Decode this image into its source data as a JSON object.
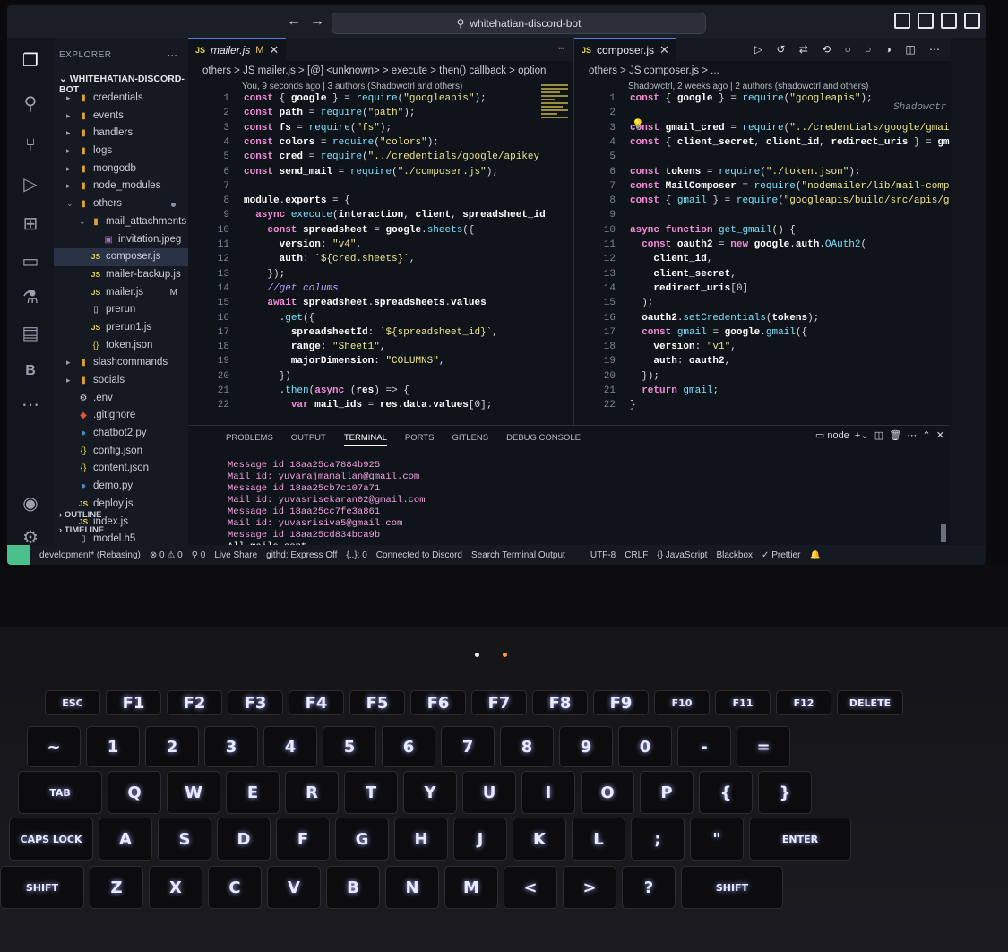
{
  "window": {
    "title": "whitehatian-discord-bot"
  },
  "explorer": {
    "header": "EXPLORER",
    "repo": "WHITEHATIAN-DISCORD-BOT",
    "items": [
      {
        "label": "credentials",
        "type": "folder",
        "indent": 1
      },
      {
        "label": "events",
        "type": "folder",
        "indent": 1
      },
      {
        "label": "handlers",
        "type": "folder",
        "indent": 1
      },
      {
        "label": "logs",
        "type": "folder",
        "indent": 1
      },
      {
        "label": "mongodb",
        "type": "folder",
        "indent": 1
      },
      {
        "label": "node_modules",
        "type": "folder",
        "indent": 1
      },
      {
        "label": "others",
        "type": "folder-open",
        "indent": 1
      },
      {
        "label": "mail_attachments",
        "type": "folder-open",
        "indent": 2
      },
      {
        "label": "invitation.jpeg",
        "type": "image",
        "indent": 3
      },
      {
        "label": "composer.js",
        "type": "js",
        "indent": 2
      },
      {
        "label": "mailer-backup.js",
        "type": "js",
        "indent": 2
      },
      {
        "label": "mailer.js",
        "type": "js",
        "indent": 2,
        "badge": "M"
      },
      {
        "label": "prerun",
        "type": "file",
        "indent": 2
      },
      {
        "label": "prerun1.js",
        "type": "js",
        "indent": 2
      },
      {
        "label": "token.json",
        "type": "json",
        "indent": 2
      },
      {
        "label": "slashcommands",
        "type": "folder",
        "indent": 1
      },
      {
        "label": "socials",
        "type": "folder",
        "indent": 1
      },
      {
        "label": ".env",
        "type": "env",
        "indent": 1
      },
      {
        "label": ".gitignore",
        "type": "git",
        "indent": 1
      },
      {
        "label": "chatbot2.py",
        "type": "py",
        "indent": 1
      },
      {
        "label": "config.json",
        "type": "json",
        "indent": 1
      },
      {
        "label": "content.json",
        "type": "json",
        "indent": 1
      },
      {
        "label": "demo.py",
        "type": "py",
        "indent": 1
      },
      {
        "label": "deploy.js",
        "type": "js",
        "indent": 1
      },
      {
        "label": "index.js",
        "type": "js",
        "indent": 1
      },
      {
        "label": "model.h5",
        "type": "file",
        "indent": 1
      }
    ],
    "outline": "OUTLINE",
    "timeline": "TIMELINE"
  },
  "left_editor": {
    "tab": "mailer.js",
    "tab_badge": "M",
    "breadcrumb": "others > JS mailer.js > [@] <unknown> > execute > then() callback > option",
    "blame": "You, 9 seconds ago | 3 authors (Shadowctrl and others)",
    "lines": [
      {
        "n": "1",
        "t": "const { google } = require(\"googleapis\");"
      },
      {
        "n": "2",
        "t": "const path = require(\"path\");"
      },
      {
        "n": "3",
        "t": "const fs = require(\"fs\");"
      },
      {
        "n": "4",
        "t": "const colors = require(\"colors\");"
      },
      {
        "n": "5",
        "t": "const cred = require(\"../credentials/google/apikey"
      },
      {
        "n": "6",
        "t": "const send_mail = require(\"./composer.js\");"
      },
      {
        "n": "7",
        "t": ""
      },
      {
        "n": "8",
        "t": "module.exports = {"
      },
      {
        "n": "9",
        "t": "  async execute(interaction, client, spreadsheet_id"
      },
      {
        "n": "10",
        "t": "    const spreadsheet = google.sheets({"
      },
      {
        "n": "11",
        "t": "      version: \"v4\","
      },
      {
        "n": "12",
        "t": "      auth: `${cred.sheets}`,"
      },
      {
        "n": "13",
        "t": "    });"
      },
      {
        "n": "14",
        "t": "    //get colums"
      },
      {
        "n": "15",
        "t": "    await spreadsheet.spreadsheets.values"
      },
      {
        "n": "16",
        "t": "      .get({"
      },
      {
        "n": "17",
        "t": "        spreadsheetId: `${spreadsheet_id}`,"
      },
      {
        "n": "18",
        "t": "        range: \"Sheet1\","
      },
      {
        "n": "19",
        "t": "        majorDimension: \"COLUMNS\","
      },
      {
        "n": "20",
        "t": "      })"
      },
      {
        "n": "21",
        "t": "      .then(async (res) => {"
      },
      {
        "n": "22",
        "t": "        var mail_ids = res.data.values[0];"
      }
    ]
  },
  "right_editor": {
    "tab": "composer.js",
    "breadcrumb": "others > JS composer.js > ...",
    "blame": "Shadowctrl, 2 weeks ago | 2 authors (shadowctrl and others)",
    "inline_blame": "Shadowctr",
    "lines": [
      {
        "n": "1",
        "t": "const { google } = require(\"googleapis\");"
      },
      {
        "n": "2",
        "t": ""
      },
      {
        "n": "3",
        "t": "const gmail_cred = require(\"../credentials/google/gmai"
      },
      {
        "n": "4",
        "t": "const { client_secret, client_id, redirect_uris } = gm"
      },
      {
        "n": "5",
        "t": ""
      },
      {
        "n": "6",
        "t": "const tokens = require(\"./token.json\");"
      },
      {
        "n": "7",
        "t": "const MailComposer = require(\"nodemailer/lib/mail-comp"
      },
      {
        "n": "8",
        "t": "const { gmail } = require(\"googleapis/build/src/apis/g"
      },
      {
        "n": "9",
        "t": ""
      },
      {
        "n": "10",
        "t": "async function get_gmail() {"
      },
      {
        "n": "11",
        "t": "  const oauth2 = new google.auth.OAuth2("
      },
      {
        "n": "12",
        "t": "    client_id,"
      },
      {
        "n": "13",
        "t": "    client_secret,"
      },
      {
        "n": "14",
        "t": "    redirect_uris[0]"
      },
      {
        "n": "15",
        "t": "  );"
      },
      {
        "n": "16",
        "t": "  oauth2.setCredentials(tokens);"
      },
      {
        "n": "17",
        "t": "  const gmail = google.gmail({"
      },
      {
        "n": "18",
        "t": "    version: \"v1\","
      },
      {
        "n": "19",
        "t": "    auth: oauth2,"
      },
      {
        "n": "20",
        "t": "  });"
      },
      {
        "n": "21",
        "t": "  return gmail;"
      },
      {
        "n": "22",
        "t": "}"
      }
    ]
  },
  "panel": {
    "tabs": [
      "PROBLEMS",
      "OUTPUT",
      "TERMINAL",
      "PORTS",
      "GITLENS",
      "DEBUG CONSOLE"
    ],
    "active_tab": "TERMINAL",
    "terminal_name": "node",
    "output": [
      "Message id 18aa25ca7884b925",
      "Mail id: yuvarajmamallan@gmail.com",
      "Message id 18aa25cb7c107a71",
      "Mail id: yuvasrisekaran02@gmail.com",
      "Message id 18aa25cc7fe3a861",
      "Mail id: yuvasrisiva5@gmail.com",
      "Message id 18aa25cd834bca9b",
      "All mails sent"
    ]
  },
  "statusbar": {
    "branch": "development* (Rebasing)",
    "problems": "⊗ 0 ⚠ 0",
    "ports": "⚲ 0",
    "liveshare": "Live Share",
    "githd": "githd: Express Off",
    "lines": "{..}: 0",
    "discord": "Connected to Discord",
    "search": "Search Terminal Output",
    "encoding": "UTF-8",
    "eol": "CRLF",
    "language": "{} JavaScript",
    "blackbox": "Blackbox",
    "prettier": "✓ Prettier"
  },
  "colors": {
    "accent": "#4e7fd8",
    "remote": "#4ac18a",
    "keyglow": "#9fa8ff"
  },
  "keyboard": {
    "rows": [
      [
        "ESC",
        "F1",
        "F2",
        "F3",
        "F4",
        "F5",
        "F6",
        "F7",
        "F8",
        "F9",
        "F10",
        "F11",
        "F12",
        "DELETE"
      ],
      [
        "~",
        "1",
        "2",
        "3",
        "4",
        "5",
        "6",
        "7",
        "8",
        "9",
        "0",
        "-",
        "="
      ],
      [
        "TAB",
        "Q",
        "W",
        "E",
        "R",
        "T",
        "Y",
        "U",
        "I",
        "O",
        "P",
        "{",
        "}"
      ],
      [
        "CAPS LOCK",
        "A",
        "S",
        "D",
        "F",
        "G",
        "H",
        "J",
        "K",
        "L",
        ";",
        "\"",
        "ENTER"
      ],
      [
        "SHIFT",
        "Z",
        "X",
        "C",
        "V",
        "B",
        "N",
        "M",
        "<",
        ">",
        "?",
        "SHIFT"
      ]
    ]
  }
}
